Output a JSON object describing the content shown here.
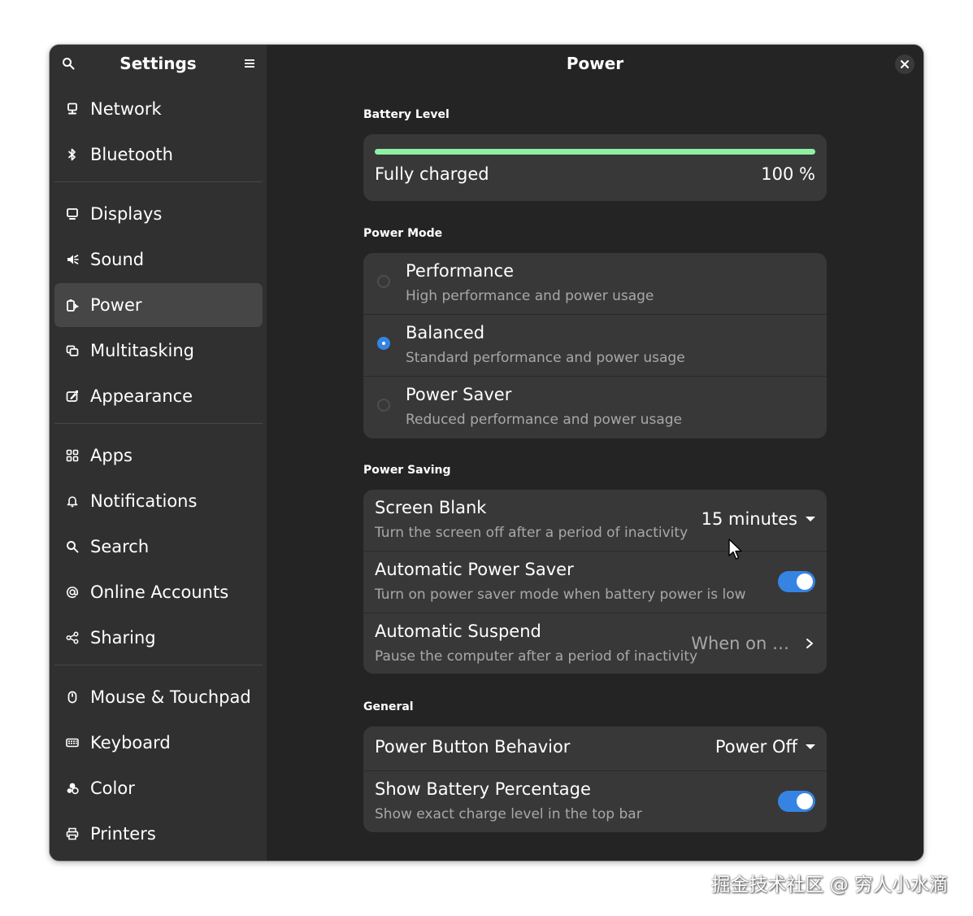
{
  "sidebar": {
    "title": "Settings",
    "groups": [
      [
        {
          "label": "Network",
          "icon": "network-icon"
        },
        {
          "label": "Bluetooth",
          "icon": "bluetooth-icon"
        }
      ],
      [
        {
          "label": "Displays",
          "icon": "display-icon"
        },
        {
          "label": "Sound",
          "icon": "sound-icon"
        },
        {
          "label": "Power",
          "icon": "power-icon",
          "active": true
        },
        {
          "label": "Multitasking",
          "icon": "multitasking-icon"
        },
        {
          "label": "Appearance",
          "icon": "appearance-icon"
        }
      ],
      [
        {
          "label": "Apps",
          "icon": "apps-icon"
        },
        {
          "label": "Notifications",
          "icon": "bell-icon"
        },
        {
          "label": "Search",
          "icon": "search-icon"
        },
        {
          "label": "Online Accounts",
          "icon": "at-icon"
        },
        {
          "label": "Sharing",
          "icon": "share-icon"
        }
      ],
      [
        {
          "label": "Mouse & Touchpad",
          "icon": "mouse-icon"
        },
        {
          "label": "Keyboard",
          "icon": "keyboard-icon"
        },
        {
          "label": "Color",
          "icon": "color-icon"
        },
        {
          "label": "Printers",
          "icon": "printer-icon"
        }
      ]
    ]
  },
  "content": {
    "title": "Power",
    "battery": {
      "section_title": "Battery Level",
      "status": "Fully charged",
      "percent_label": "100 %",
      "level": 1.0,
      "bar_color": "#8ff0a4"
    },
    "power_mode": {
      "section_title": "Power Mode",
      "options": [
        {
          "title": "Performance",
          "subtitle": "High performance and power usage",
          "selected": false
        },
        {
          "title": "Balanced",
          "subtitle": "Standard performance and power usage",
          "selected": true
        },
        {
          "title": "Power Saver",
          "subtitle": "Reduced performance and power usage",
          "selected": false
        }
      ]
    },
    "power_saving": {
      "section_title": "Power Saving",
      "screen_blank": {
        "title": "Screen Blank",
        "subtitle": "Turn the screen off after a period of inactivity",
        "value": "15 minutes"
      },
      "auto_power_saver": {
        "title": "Automatic Power Saver",
        "subtitle": "Turn on power saver mode when battery power is low",
        "enabled": true
      },
      "auto_suspend": {
        "title": "Automatic Suspend",
        "subtitle": "Pause the computer after a period of inactivity",
        "value": "When on …"
      }
    },
    "general": {
      "section_title": "General",
      "power_button": {
        "title": "Power Button Behavior",
        "value": "Power Off"
      },
      "battery_percentage": {
        "title": "Show Battery Percentage",
        "subtitle": "Show exact charge level in the top bar",
        "enabled": true
      }
    }
  },
  "accent_color": "#3584e4",
  "watermark": "掘金技术社区 @ 穷人小水滴"
}
